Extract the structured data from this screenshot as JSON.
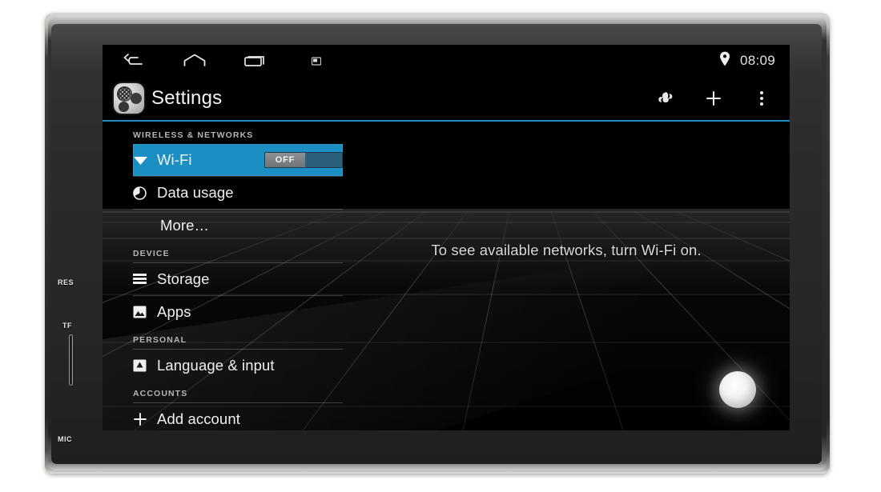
{
  "device": {
    "bezel_labels": [
      {
        "id": "res",
        "text": "RES"
      },
      {
        "id": "tf",
        "text": "TF"
      },
      {
        "id": "mic",
        "text": "MIC"
      }
    ]
  },
  "statusbar": {
    "nav": [
      {
        "name": "back-icon",
        "label": "Back"
      },
      {
        "name": "home-icon",
        "label": "Home"
      },
      {
        "name": "recents-icon",
        "label": "Recent apps"
      },
      {
        "name": "screenshot-icon",
        "label": "Screenshot"
      }
    ],
    "location_icon": "location-pin-icon",
    "time": "08:09"
  },
  "actionbar": {
    "app_icon": "settings-app-icon",
    "title": "Settings",
    "actions": [
      {
        "name": "sync-icon",
        "label": "Sync"
      },
      {
        "name": "add-icon",
        "label": "Add"
      },
      {
        "name": "overflow-icon",
        "label": "More options"
      }
    ],
    "accent_color": "#1d8bc4"
  },
  "settings": {
    "sections": [
      {
        "header": "WIRELESS & NETWORKS",
        "rows": [
          {
            "label": "Wi-Fi",
            "icon": "wifi-icon",
            "selected": true,
            "toggle": {
              "state": "OFF"
            }
          },
          {
            "label": "Data usage",
            "icon": "data-usage-icon",
            "selected": false
          },
          {
            "label": "More…",
            "icon": "none",
            "selected": false,
            "indent": true
          }
        ]
      },
      {
        "header": "DEVICE",
        "rows": [
          {
            "label": "Storage",
            "icon": "storage-icon",
            "selected": false
          },
          {
            "label": "Apps",
            "icon": "apps-icon",
            "selected": false
          }
        ]
      },
      {
        "header": "PERSONAL",
        "rows": [
          {
            "label": "Language & input",
            "icon": "language-input-icon",
            "selected": false
          }
        ]
      },
      {
        "header": "ACCOUNTS",
        "rows": [
          {
            "label": "Add account",
            "icon": "plus-icon",
            "selected": false
          }
        ]
      }
    ],
    "selected_color": "#1b8ec4"
  },
  "detail": {
    "message": "To see available networks, turn Wi-Fi on."
  },
  "hardware": {
    "volume_knob": "volume-knob"
  }
}
